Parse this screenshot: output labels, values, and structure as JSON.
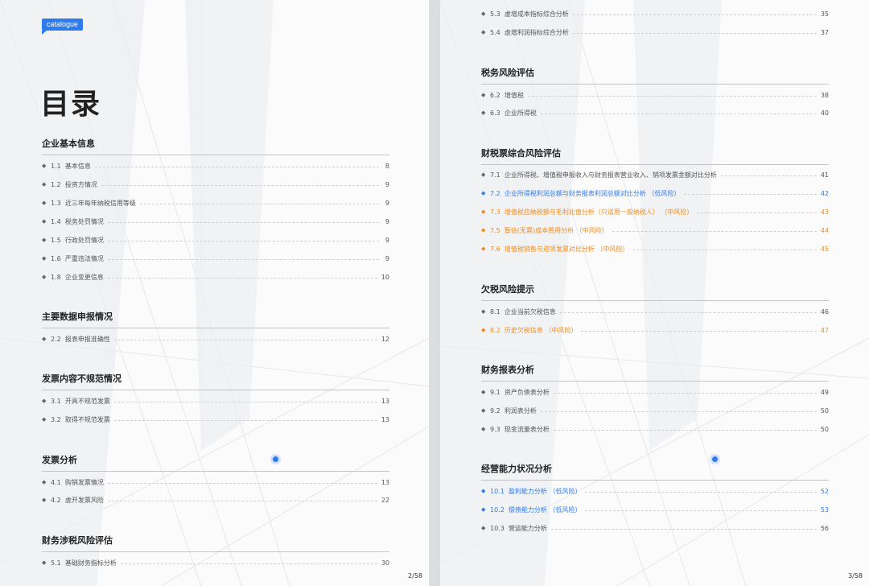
{
  "left": {
    "badge": "catalogue",
    "title": "目录",
    "page_number": "2/58",
    "sections": [
      {
        "title": "企业基本信息",
        "items": [
          {
            "num": "1.1",
            "label": "基本信息",
            "page": "8"
          },
          {
            "num": "1.2",
            "label": "投资方情况",
            "page": "9"
          },
          {
            "num": "1.3",
            "label": "近三年每年纳税信用等级",
            "page": "9"
          },
          {
            "num": "1.4",
            "label": "税务处罚情况",
            "page": "9"
          },
          {
            "num": "1.5",
            "label": "行政处罚情况",
            "page": "9"
          },
          {
            "num": "1.6",
            "label": "严重违法情况",
            "page": "9"
          },
          {
            "num": "1.8",
            "label": "企业变更信息",
            "page": "10"
          }
        ]
      },
      {
        "title": "主要数据申报情况",
        "items": [
          {
            "num": "2.2",
            "label": "报表申报准确性",
            "page": "12"
          }
        ]
      },
      {
        "title": "发票内容不规范情况",
        "items": [
          {
            "num": "3.1",
            "label": "开具不规范发票",
            "page": "13"
          },
          {
            "num": "3.2",
            "label": "取得不规范发票",
            "page": "13"
          }
        ]
      },
      {
        "title": "发票分析",
        "items": [
          {
            "num": "4.1",
            "label": "购销发票情况",
            "page": "13"
          },
          {
            "num": "4.2",
            "label": "虚开发票风险",
            "page": "22"
          }
        ]
      },
      {
        "title": "财务涉税风险评估",
        "items": [
          {
            "num": "5.1",
            "label": "基础财务指标分析",
            "page": "30"
          }
        ]
      }
    ]
  },
  "right": {
    "page_number": "3/58",
    "top_items": [
      {
        "num": "5.3",
        "label": "虚增成本指标综合分析",
        "page": "35"
      },
      {
        "num": "5.4",
        "label": "虚增利润指标综合分析",
        "page": "37"
      }
    ],
    "sections": [
      {
        "title": "税务风险评估",
        "items": [
          {
            "num": "6.2",
            "label": "增值税",
            "page": "38"
          },
          {
            "num": "6.3",
            "label": "企业所得税",
            "page": "40"
          }
        ]
      },
      {
        "title": "财税票综合风险评估",
        "items": [
          {
            "num": "7.1",
            "label": "企业所得税、增值税申报收入与财务报表营业收入、销项发票金额对比分析",
            "page": "41"
          },
          {
            "num": "7.2",
            "label": "企业所得税利润总额与财务报表利润总额对比分析 （低风险）",
            "page": "42",
            "color": "blue"
          },
          {
            "num": "7.3",
            "label": "增值税应纳税额与毛利比值分析（只适用一般纳税人） （中风险）",
            "page": "43",
            "color": "orange"
          },
          {
            "num": "7.5",
            "label": "暂估(无票)成本费用分析 （中风险）",
            "page": "44",
            "color": "orange"
          },
          {
            "num": "7.6",
            "label": "增值税销售与进项发票对比分析 （中风险）",
            "page": "45",
            "color": "orange"
          }
        ]
      },
      {
        "title": "欠税风险提示",
        "items": [
          {
            "num": "8.1",
            "label": "企业当前欠税信息",
            "page": "46"
          },
          {
            "num": "8.2",
            "label": "历史欠税信息 （中风险）",
            "page": "47",
            "color": "orange"
          }
        ]
      },
      {
        "title": "财务报表分析",
        "items": [
          {
            "num": "9.1",
            "label": "资产负债表分析",
            "page": "49"
          },
          {
            "num": "9.2",
            "label": "利润表分析",
            "page": "50"
          },
          {
            "num": "9.3",
            "label": "现金流量表分析",
            "page": "50"
          }
        ]
      },
      {
        "title": "经营能力状况分析",
        "items": [
          {
            "num": "10.1",
            "label": "盈利能力分析 （低风险）",
            "page": "52",
            "color": "blue"
          },
          {
            "num": "10.2",
            "label": "偿债能力分析 （低风险）",
            "page": "53",
            "color": "blue"
          },
          {
            "num": "10.3",
            "label": "营运能力分析",
            "page": "56"
          }
        ]
      }
    ]
  },
  "colors": {
    "blue": "#2e7bf0",
    "orange": "#f08c1e"
  }
}
